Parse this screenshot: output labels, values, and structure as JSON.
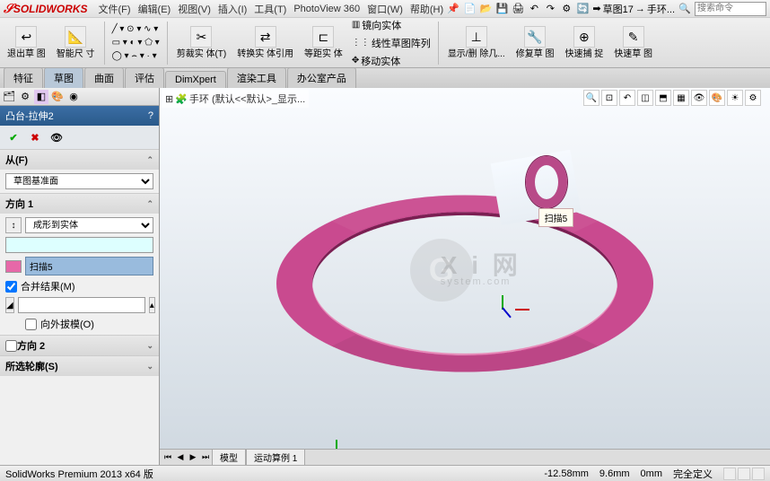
{
  "app": {
    "name": "SOLIDWORKS"
  },
  "menu": {
    "file": "文件(F)",
    "edit": "编辑(E)",
    "view": "视图(V)",
    "insert": "插入(I)",
    "tools": "工具(T)",
    "photoview": "PhotoView 360",
    "window": "窗口(W)",
    "help": "帮助(H)"
  },
  "breadcrumb": {
    "item1": "草图17",
    "item2": "手环..."
  },
  "search": {
    "placeholder": "搜索命令"
  },
  "ribbon": {
    "exit_sketch": "退出草\n图",
    "smart_dim": "智能尺\n寸",
    "trim": "剪裁实\n体(T)",
    "convert": "转换实\n体引用",
    "offset": "等距实\n体",
    "mirror": "镜向实体",
    "linear_pattern": "线性草图阵列",
    "move": "移动实体",
    "display_delete": "显示/删\n除几...",
    "repair": "修复草\n图",
    "quick_snap": "快速捕\n捉",
    "rapid_sketch": "快速草\n图"
  },
  "tabs": {
    "feature": "特征",
    "sketch": "草图",
    "surface": "曲面",
    "evaluate": "评估",
    "dimxpert": "DimXpert",
    "render": "渲染工具",
    "office": "办公室产品"
  },
  "feature": {
    "title": "凸台-拉伸2",
    "from": {
      "header": "从(F)",
      "plane": "草图基准面"
    },
    "dir1": {
      "header": "方向 1",
      "type": "成形到实体",
      "selected": "扫描5",
      "merge": "合并结果(M)",
      "outward": "向外拔模(O)"
    },
    "dir2": {
      "header": "方向 2"
    },
    "contours": {
      "header": "所选轮廓(S)"
    }
  },
  "tree": {
    "root": "手环  (默认<<默认>_显示..."
  },
  "callout": {
    "text": "扫描5"
  },
  "bottom_tabs": {
    "model": "模型",
    "motion": "运动算例 1"
  },
  "status": {
    "version": "SolidWorks Premium 2013 x64 版",
    "x": "-12.58mm",
    "y": "9.6mm",
    "z": "0mm",
    "state": "完全定义"
  },
  "watermark": {
    "text1": "X i 网",
    "text2": "system.com",
    "circle": "G"
  }
}
